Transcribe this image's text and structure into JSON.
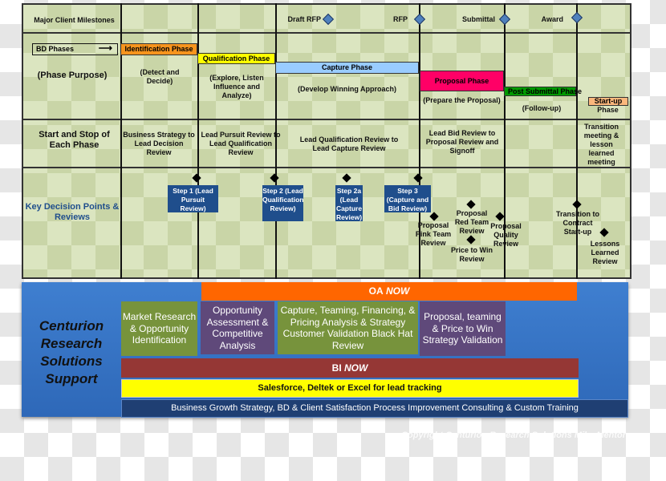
{
  "milestones": {
    "row_label": "Major Client Milestones",
    "items": [
      "Draft RFP",
      "RFP",
      "Submittal",
      "Award"
    ],
    "diamond_color": "#4f81bd"
  },
  "phases": {
    "bd_label": "BD Phases",
    "purpose_label": "(Phase Purpose)",
    "items": [
      {
        "name": "Identification Phase",
        "purpose": "(Detect and Decide)",
        "color": "#f7941d"
      },
      {
        "name": "Qualification Phase",
        "purpose": "(Explore, Listen Influence and Analyze)",
        "color": "#ffff00"
      },
      {
        "name": "Capture  Phase",
        "purpose": "(Develop Winning Approach)",
        "color": "#99ccff"
      },
      {
        "name": "Proposal Phase",
        "purpose": "(Prepare the Proposal)",
        "color": "#ff0066"
      },
      {
        "name": "Post Submittal Phase",
        "purpose": "(Follow-up)",
        "color": "#009900"
      },
      {
        "name": "Start-up",
        "name2": "Phase",
        "color": "#fbb77c"
      }
    ]
  },
  "start_stop": {
    "row_label": "Start and Stop of Each Phase",
    "items": [
      "Business Strategy to Lead Decision Review",
      "Lead Pursuit Review to Lead Qualification Review",
      "Lead Qualification Review to Lead Capture Review",
      "Lead Bid Review to Proposal Review and Signoff",
      "Transition meeting & lesson learned meeting"
    ]
  },
  "decisions": {
    "row_label": "Key Decision Points & Reviews",
    "steps": [
      "Step 1 (Lead Pursuit  Review)",
      "Step 2 (Lead Qualification Review)",
      "Step 2a (Lead Capture Review)",
      "Step 3 (Capture and Bid Review)"
    ],
    "reviews": [
      "Proposal Pink Team Review",
      "Proposal Red Team Review",
      "Price to Win Review",
      "Proposal Quality Review",
      "Transition to Contract Start-up",
      "Lessons Learned Review"
    ]
  },
  "support": {
    "title": "Centurion Research Solutions Support",
    "oa": "OA",
    "oa_now": "NOW",
    "bi": "BI",
    "bi_now": "NOW",
    "boxes": [
      "Market Research & Opportunity Identification",
      "Opportunity Assessment & Competitive Analysis",
      "Capture, Teaming, Financing, & Pricing Analysis & Strategy Customer Validation Black Hat Review",
      "Proposal, teaming & Price to Win Strategy Validation"
    ],
    "tracking": "Salesforce, Deltek or Excel for lead tracking",
    "consulting": "Business Growth Strategy, BD & Client Satisfaction Process Improvement Consulting & Custom Training"
  },
  "copyright": "Copyright Centurion Research Solutions Mike Mentor"
}
